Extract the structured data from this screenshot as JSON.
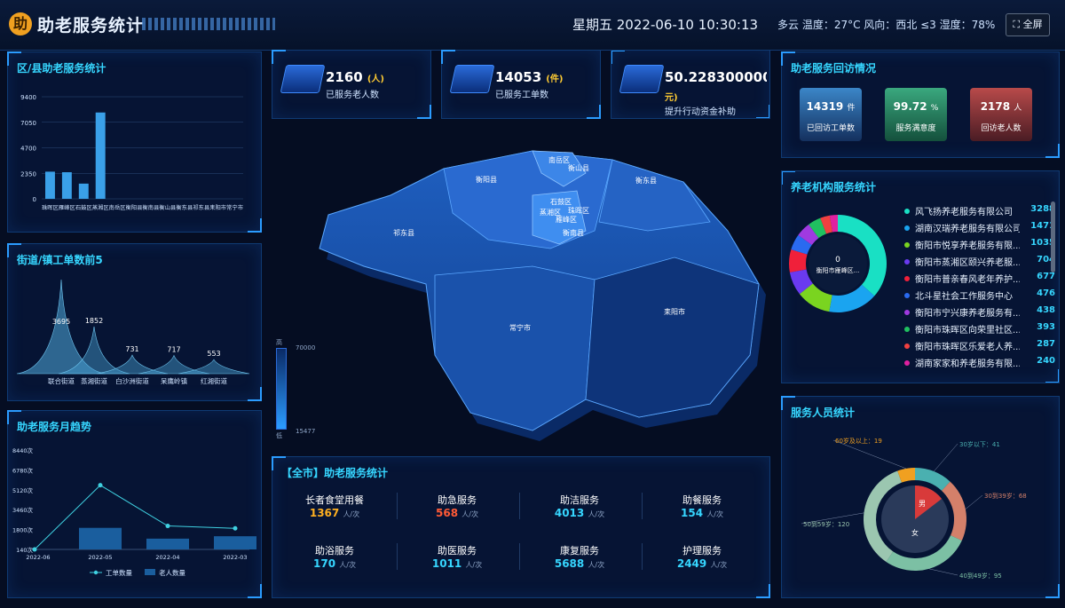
{
  "header": {
    "logo_text": "助",
    "title": "助老服务统计",
    "datetime": "星期五 2022-06-10 10:30:13",
    "weather": "多云  温度：27°C  风向：西北 ≤3  湿度：78%",
    "fullscreen_label": "全屏"
  },
  "district_chart": {
    "title": "区/县助老服务统计",
    "y_ticks": [
      "9400",
      "7050",
      "4700",
      "2350",
      "0"
    ],
    "chart_data": {
      "type": "bar",
      "categories": [
        "珠晖区",
        "雁峰区",
        "石鼓区",
        "蒸湘区",
        "南岳区",
        "衡阳县",
        "衡南县",
        "衡山县",
        "衡东县",
        "祁东县",
        "耒阳市",
        "常宁市"
      ],
      "values": [
        2500,
        2450,
        1400,
        7950,
        0,
        0,
        0,
        0,
        0,
        0,
        0,
        0
      ],
      "ylim": [
        0,
        9400
      ],
      "x_tick_text": "珠晖区雁峰区石鼓区蒸湘区南岳区衡阳县衡南县衡山县衡东县祁东县耒阳市常宁市"
    }
  },
  "street_chart": {
    "title": "街道/镇工单数前5",
    "chart_data": {
      "type": "area",
      "categories": [
        "联合街道",
        "蒸湘街道",
        "白沙洲街道",
        "呆鹰岭镇",
        "红湘街道"
      ],
      "values": [
        3695,
        1852,
        731,
        717,
        553
      ]
    }
  },
  "trend_chart": {
    "title": "助老服务月趋势",
    "y_ticks": [
      "8440次",
      "6780次",
      "5120次",
      "3460次",
      "1800次",
      "140次"
    ],
    "chart_data": {
      "type": "line",
      "categories": [
        "2022-06",
        "2022-05",
        "2022-04",
        "2022-03"
      ],
      "series": [
        {
          "name": "工单数量",
          "values": [
            140,
            5500,
            2100,
            1900
          ]
        },
        {
          "name": "老人数量",
          "values": [
            0,
            1800,
            900,
            1100
          ]
        }
      ],
      "ylim": [
        140,
        8440
      ]
    }
  },
  "kpis": [
    {
      "value": "2160",
      "unit": "(人)",
      "label": "已服务老人数"
    },
    {
      "value": "14053",
      "unit": "(件)",
      "label": "已服务工单数"
    },
    {
      "value": "50.2283000000000",
      "unit": "元)",
      "label": "提升行动资金补助"
    }
  ],
  "map": {
    "legend_high": "70000",
    "legend_low": "15477",
    "legend_top_char": "高",
    "legend_bottom_char": "低",
    "regions": [
      "南岳区",
      "衡山县",
      "衡阳县",
      "衡东县",
      "石鼓区",
      "蒸湘区",
      "珠晖区",
      "雁峰区",
      "衡南县",
      "祁东县",
      "常宁市",
      "耒阳市"
    ]
  },
  "city_services": {
    "title": "【全市】助老服务统计",
    "unit": "人/次",
    "items": [
      {
        "name": "长者食堂用餐",
        "value": "1367",
        "color": "#ffb020"
      },
      {
        "name": "助急服务",
        "value": "568",
        "color": "#ff5a36"
      },
      {
        "name": "助洁服务",
        "value": "4013",
        "color": "#36d6ff"
      },
      {
        "name": "助餐服务",
        "value": "154",
        "color": "#36d6ff"
      },
      {
        "name": "助浴服务",
        "value": "170",
        "color": "#36d6ff"
      },
      {
        "name": "助医服务",
        "value": "1011",
        "color": "#36d6ff"
      },
      {
        "name": "康复服务",
        "value": "5688",
        "color": "#36d6ff"
      },
      {
        "name": "护理服务",
        "value": "2449",
        "color": "#36d6ff"
      }
    ]
  },
  "revisit": {
    "title": "助老服务回访情况",
    "cards": [
      {
        "value": "14319",
        "unit": "件",
        "label": "已回访工单数",
        "color": "#2e6fb5"
      },
      {
        "value": "99.72",
        "unit": "%",
        "label": "服务满意度",
        "color": "#2c8a6a"
      },
      {
        "value": "2178",
        "unit": "人",
        "label": "回访老人数",
        "color": "#9a3a3a"
      }
    ]
  },
  "orgs": {
    "title": "养老机构服务统计",
    "center_value": "0",
    "center_label": "衡阳市雁峰区...",
    "chart_data": {
      "type": "pie",
      "categories": [
        "风飞扬养老服务有限公司",
        "湖南汉瑞养老服务有限公司",
        "衡阳市悦享养老服务有限...",
        "衡阳市蒸湘区颐兴养老服...",
        "衡阳市普亲春风老年养护...",
        "北斗星社会工作服务中心",
        "衡阳市宁兴康养老服务有...",
        "衡阳市珠晖区向荣里社区...",
        "衡阳市珠晖区乐爱老人养...",
        "湖南家家和养老服务有限..."
      ],
      "values": [
        3288,
        1471,
        1035,
        704,
        677,
        476,
        438,
        393,
        287,
        240
      ]
    },
    "colors": [
      "#19e0c4",
      "#1aa4f0",
      "#7ad420",
      "#6a3af0",
      "#f0203a",
      "#2a6af0",
      "#a03ae0",
      "#20c060",
      "#f04040",
      "#e020a0"
    ]
  },
  "staff": {
    "title": "服务人员统计",
    "male": "男",
    "female": "女",
    "chart_data": {
      "type": "pie",
      "categories": [
        "30岁以下",
        "30到39岁",
        "40到49岁",
        "50到59岁",
        "60岁及以上"
      ],
      "values": [
        41,
        68,
        95,
        120,
        19
      ]
    },
    "labels": [
      "30岁以下：41",
      "30到39岁：68",
      "40到49岁：95",
      "50到59岁：120",
      "60岁及以上：19"
    ],
    "colors": [
      "#4ab0b0",
      "#d4806a",
      "#7cc0a4",
      "#9bc6b0",
      "#f0a020"
    ]
  },
  "legend": {
    "work": "工单数量",
    "elder": "老人数量"
  }
}
